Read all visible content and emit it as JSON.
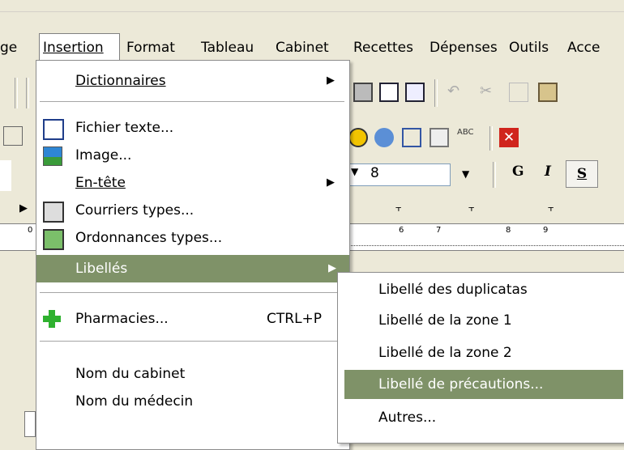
{
  "menubar": {
    "partial_left": "ge",
    "items": [
      {
        "label": "Insertion"
      },
      {
        "label": "Format"
      },
      {
        "label": "Tableau"
      },
      {
        "label": "Cabinet"
      },
      {
        "label": "Recettes"
      },
      {
        "label": "Dépenses"
      },
      {
        "label": "Outils"
      },
      {
        "label": "Acce"
      }
    ]
  },
  "toolbar": {
    "font_size": "8",
    "bold": "G",
    "italic": "I",
    "underline": "S",
    "ruler_numbers": [
      "0",
      "6",
      "7",
      "8",
      "9"
    ]
  },
  "insert_menu": {
    "items": [
      {
        "label": "Dictionnaires",
        "icon": "none",
        "submenu": true
      },
      {
        "label": "Fichier texte...",
        "icon": "text-file-icon"
      },
      {
        "label": "Image...",
        "icon": "image-icon"
      },
      {
        "label": "En-tête",
        "icon": "none",
        "submenu": true
      },
      {
        "label": "Courriers types...",
        "icon": "letters-icon"
      },
      {
        "label": "Ordonnances types...",
        "icon": "prescriptions-icon"
      },
      {
        "label": "Libellés",
        "icon": "none",
        "submenu": true,
        "highlighted": true
      },
      {
        "label": "Pharmacies...",
        "icon": "green-cross-icon",
        "shortcut": "CTRL+P"
      },
      {
        "label": "Nom du cabinet",
        "icon": "none"
      },
      {
        "label": "Nom du médecin",
        "icon": "none"
      }
    ],
    "arrow_glyph": "▶"
  },
  "libelles_submenu": {
    "items": [
      {
        "label": "Libellé des duplicatas"
      },
      {
        "label": "Libellé de la zone 1"
      },
      {
        "label": "Libellé de la zone 2"
      },
      {
        "label": "Libellé de précautions...",
        "highlighted": true
      },
      {
        "label": "Autres..."
      }
    ]
  },
  "colors": {
    "menu_highlight": "#7f9268",
    "window_bg": "#ece9d8"
  }
}
